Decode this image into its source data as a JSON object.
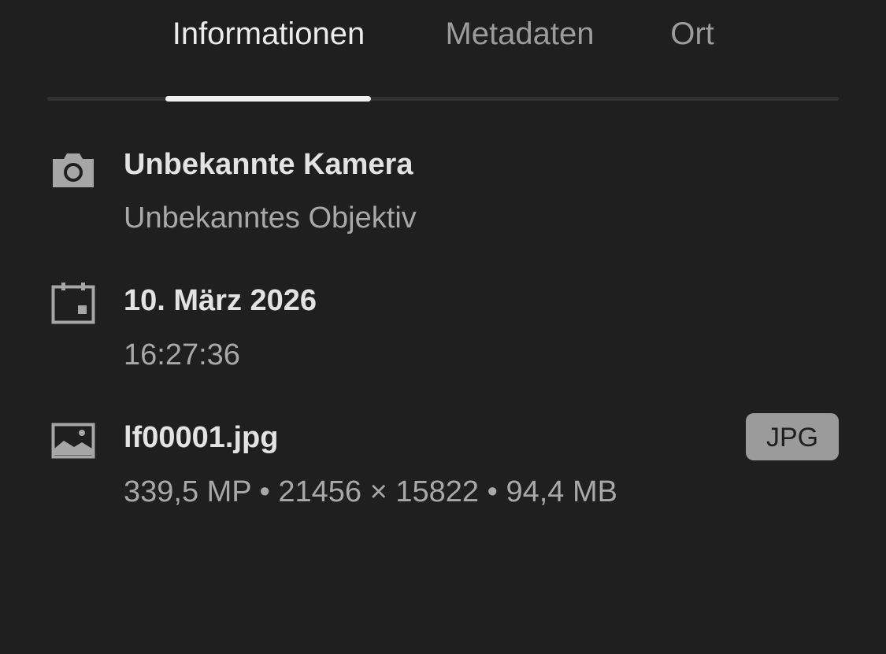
{
  "tabs": [
    {
      "label": "Informationen",
      "active": true
    },
    {
      "label": "Metadaten",
      "active": false
    },
    {
      "label": "Ort",
      "active": false
    }
  ],
  "camera": {
    "icon": "camera-icon",
    "name": "Unbekannte Kamera",
    "lens": "Unbekanntes Objektiv"
  },
  "date": {
    "icon": "calendar-icon",
    "date": "10. März 2026",
    "time": "16:27:36"
  },
  "file": {
    "icon": "image-icon",
    "name": "lf00001.jpg",
    "details": "339,5 MP • 21456 × 15822 • 94,4 MB",
    "format_badge": "JPG"
  },
  "colors": {
    "background": "#1f1f1f",
    "active_tab": "#ececec",
    "inactive_tab": "#9c9c9c",
    "badge": "#9b9b9b"
  }
}
